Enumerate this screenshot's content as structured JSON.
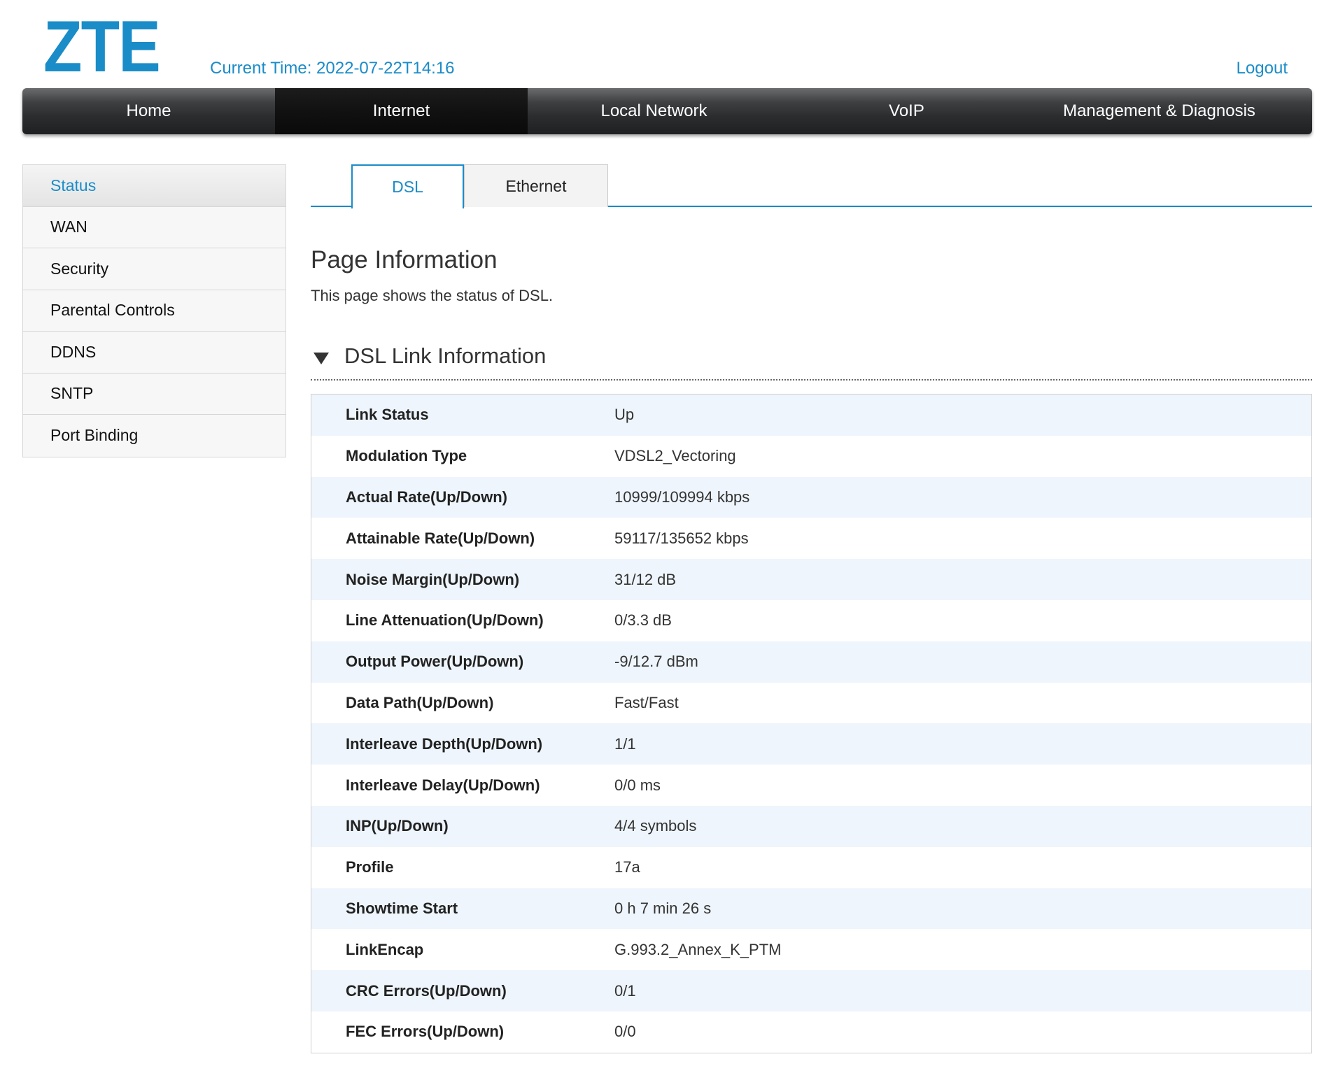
{
  "header": {
    "logo_text": "ZTE",
    "current_time_label": "Current Time:",
    "current_time_value": "2022-07-22T14:16",
    "logout_label": "Logout",
    "brand_color": "#1a8cc8"
  },
  "mainnav": {
    "items": [
      {
        "label": "Home"
      },
      {
        "label": "Internet"
      },
      {
        "label": "Local Network"
      },
      {
        "label": "VoIP"
      },
      {
        "label": "Management & Diagnosis"
      }
    ],
    "active": "Internet"
  },
  "sidebar": {
    "items": [
      {
        "label": "Status"
      },
      {
        "label": "WAN"
      },
      {
        "label": "Security"
      },
      {
        "label": "Parental Controls"
      },
      {
        "label": "DDNS"
      },
      {
        "label": "SNTP"
      },
      {
        "label": "Port Binding"
      }
    ],
    "active": "Status"
  },
  "tabs": {
    "items": [
      {
        "label": "DSL"
      },
      {
        "label": "Ethernet"
      }
    ],
    "active": "DSL"
  },
  "page": {
    "title": "Page Information",
    "description": "This page shows the status of DSL."
  },
  "section": {
    "title": "DSL Link Information",
    "expanded": true,
    "rows": [
      {
        "label": "Link Status",
        "value": "Up"
      },
      {
        "label": "Modulation Type",
        "value": "VDSL2_Vectoring"
      },
      {
        "label": "Actual Rate(Up/Down)",
        "value": "10999/109994 kbps"
      },
      {
        "label": "Attainable Rate(Up/Down)",
        "value": "59117/135652 kbps"
      },
      {
        "label": "Noise Margin(Up/Down)",
        "value": "31/12 dB"
      },
      {
        "label": "Line Attenuation(Up/Down)",
        "value": "0/3.3 dB"
      },
      {
        "label": "Output Power(Up/Down)",
        "value": "-9/12.7 dBm"
      },
      {
        "label": "Data Path(Up/Down)",
        "value": "Fast/Fast"
      },
      {
        "label": "Interleave Depth(Up/Down)",
        "value": "1/1"
      },
      {
        "label": "Interleave Delay(Up/Down)",
        "value": "0/0 ms"
      },
      {
        "label": "INP(Up/Down)",
        "value": "4/4 symbols"
      },
      {
        "label": "Profile",
        "value": "17a"
      },
      {
        "label": "Showtime Start",
        "value": "0 h 7 min 26 s"
      },
      {
        "label": "LinkEncap",
        "value": "G.993.2_Annex_K_PTM"
      },
      {
        "label": "CRC Errors(Up/Down)",
        "value": "0/1"
      },
      {
        "label": "FEC Errors(Up/Down)",
        "value": "0/0"
      }
    ]
  }
}
